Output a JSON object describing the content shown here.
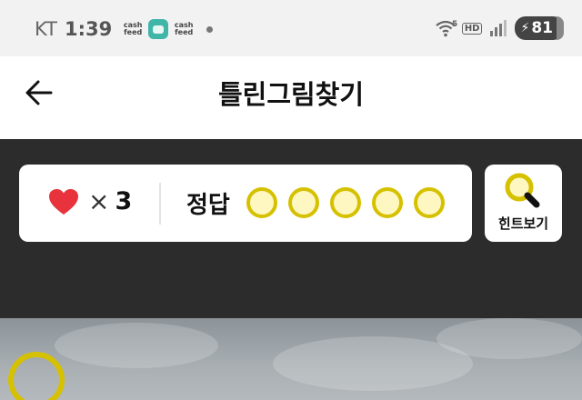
{
  "status_bar": {
    "carrier": "KT",
    "time": "1:39",
    "notification_app_1": "cash feed",
    "notification_app_2": "cash feed",
    "network": "5",
    "hd": "HD",
    "battery": "81"
  },
  "header": {
    "title": "틀린그림찾기",
    "back_icon": "arrow-left-icon"
  },
  "game_status": {
    "lives_icon": "heart-icon",
    "times_symbol": "×",
    "lives_count": "3",
    "answer_label": "정답",
    "answers_found": 0,
    "answers_total": 5
  },
  "hint": {
    "icon": "magnifier-icon",
    "label": "힌트보기"
  },
  "colors": {
    "accent": "#d5c100",
    "heart": "#e8323c",
    "dark_panel": "#2c2c2c"
  }
}
